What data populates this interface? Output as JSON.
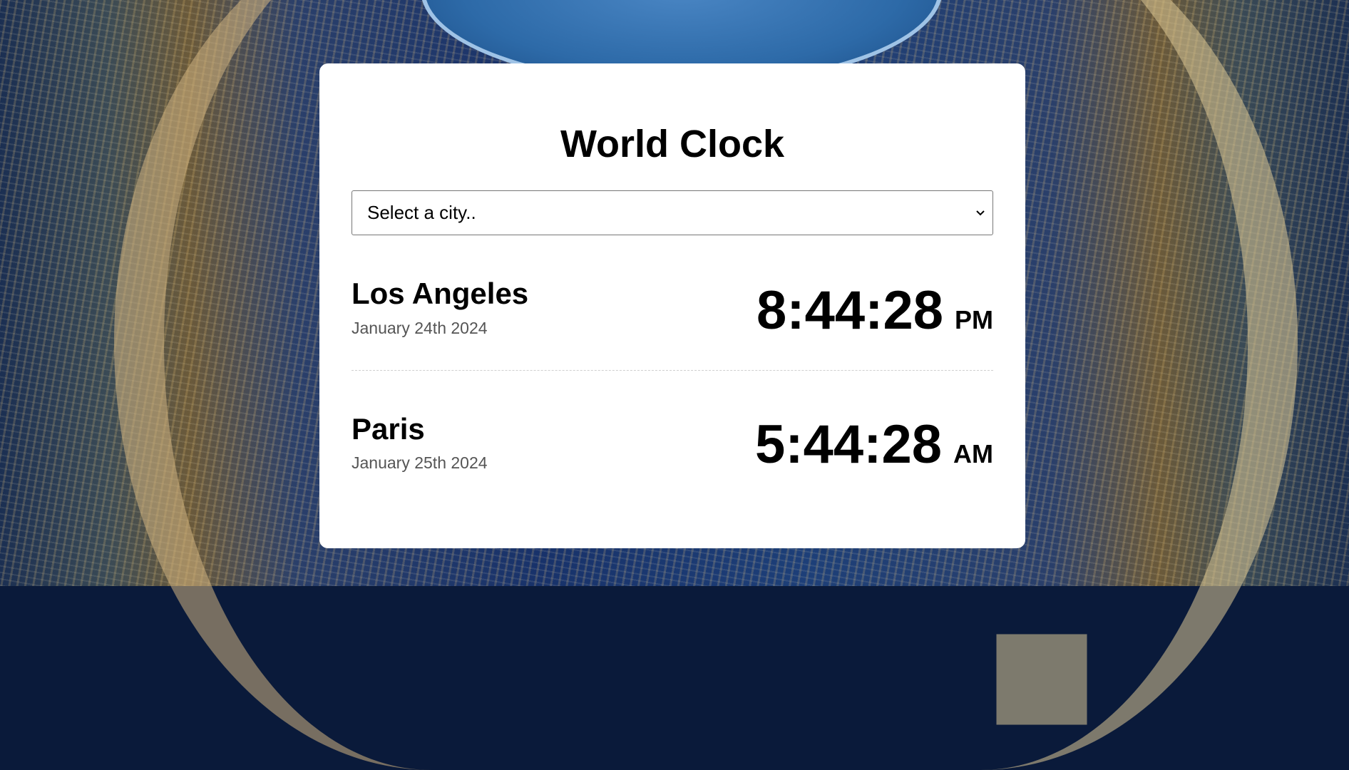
{
  "app": {
    "title": "World Clock"
  },
  "city_select": {
    "selected_label": "Select a city.."
  },
  "cities": [
    {
      "name": "Los Angeles",
      "date": "January 24th 2024",
      "time": "8:44:28",
      "ampm": "PM"
    },
    {
      "name": "Paris",
      "date": "January 25th 2024",
      "time": "5:44:28",
      "ampm": "AM"
    }
  ],
  "icons": {
    "select_chevron": "chevron-down-icon"
  },
  "colors": {
    "card_background": "#ffffff",
    "date_text": "#555555",
    "divider": "#cfcfcf"
  }
}
